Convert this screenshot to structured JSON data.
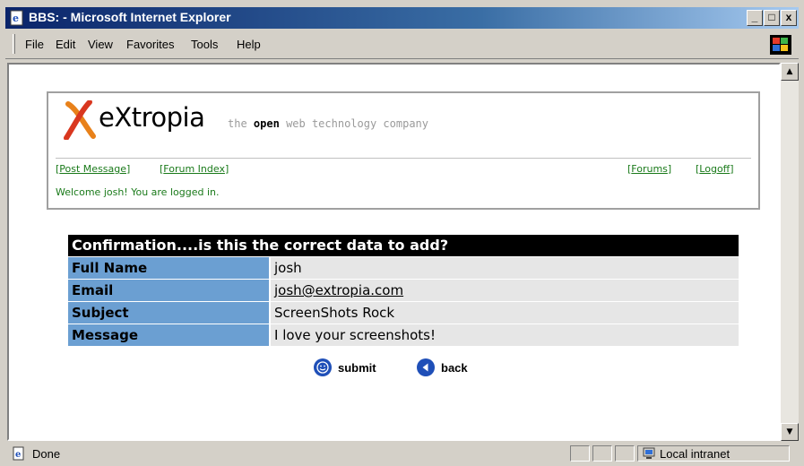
{
  "window": {
    "title": "BBS: - Microsoft Internet Explorer",
    "minimize_glyph": "_",
    "maximize_glyph": "□",
    "close_glyph": "x"
  },
  "menu": {
    "items": [
      {
        "label": "File"
      },
      {
        "label": "Edit"
      },
      {
        "label": "View"
      },
      {
        "label": "Favorites"
      },
      {
        "label": "Tools"
      },
      {
        "label": "Help"
      }
    ]
  },
  "header": {
    "logo_text": "eXtropia",
    "tagline_prefix": "the",
    "tagline_bold": "open",
    "tagline_suffix": "web technology company"
  },
  "nav": {
    "post_message": "Post Message",
    "forum_index": "Forum Index",
    "forums": "Forums",
    "logoff": "Logoff",
    "welcome": "Welcome josh! You are logged in."
  },
  "confirmation": {
    "heading": "Confirmation....is this the correct data to add?",
    "rows": [
      {
        "label": "Full Name",
        "value": "josh"
      },
      {
        "label": "Email",
        "value": "josh@extropia.com"
      },
      {
        "label": "Subject",
        "value": "ScreenShots Rock"
      },
      {
        "label": "Message",
        "value": "I love your screenshots!"
      }
    ],
    "submit_label": "submit",
    "back_label": "back"
  },
  "status": {
    "text": "Done",
    "zone": "Local intranet"
  },
  "colors": {
    "title_bar": "#0a246a",
    "label_cell": "#6b9fd2",
    "value_cell": "#e6e6e6",
    "nav_link": "#1a7a1a",
    "logo_accent": "#e8811a"
  },
  "icons": {
    "title": "ie-page-icon",
    "windows_logo": "windows-flag-icon",
    "submit": "smiley-icon",
    "back": "back-arrow-icon",
    "status_page": "page-icon",
    "zone": "intranet-icon"
  }
}
